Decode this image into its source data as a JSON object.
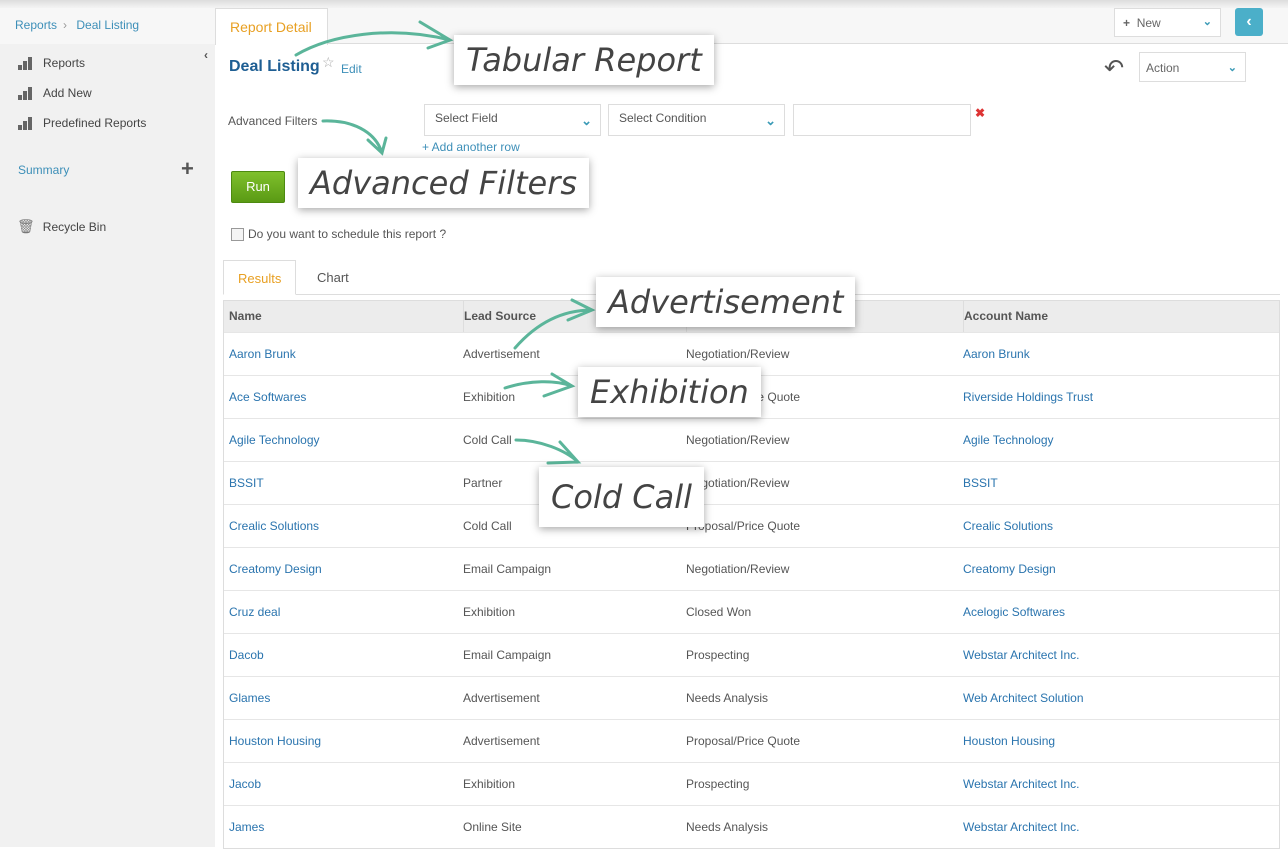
{
  "breadcrumb": {
    "root": "Reports",
    "current": "Deal Listing"
  },
  "sidebar": {
    "items": [
      {
        "label": "Reports",
        "icon": "bar-chart-icon"
      },
      {
        "label": "Add New",
        "icon": "bar-chart-add-icon"
      },
      {
        "label": "Predefined Reports",
        "icon": "bar-chart-icon"
      }
    ],
    "summary": "Summary",
    "recycle": "Recycle Bin"
  },
  "header": {
    "tab": "Report Detail",
    "new_label": "New",
    "action_label": "Action"
  },
  "report": {
    "title": "Deal Listing",
    "edit": "Edit"
  },
  "filters": {
    "label": "Advanced Filters",
    "field_placeholder": "Select Field",
    "condition_placeholder": "Select Condition",
    "value": "",
    "add_row": "+ Add another row",
    "run": "Run",
    "schedule": "Do you want to schedule this report ?"
  },
  "tabs": {
    "results": "Results",
    "chart": "Chart"
  },
  "table": {
    "columns": [
      "Name",
      "Lead Source",
      "",
      "Account Name"
    ],
    "rows": [
      [
        "Aaron Brunk",
        "Advertisement",
        "Negotiation/Review",
        "Aaron Brunk"
      ],
      [
        "Ace Softwares",
        "Exhibition",
        "Proposal/Price Quote",
        "Riverside Holdings Trust"
      ],
      [
        "Agile Technology",
        "Cold Call",
        "Negotiation/Review",
        "Agile Technology"
      ],
      [
        "BSSIT",
        "Partner",
        "Negotiation/Review",
        "BSSIT"
      ],
      [
        "Crealic Solutions",
        "Cold Call",
        "Proposal/Price Quote",
        "Crealic Solutions"
      ],
      [
        "Creatomy Design",
        "Email Campaign",
        "Negotiation/Review",
        "Creatomy Design"
      ],
      [
        "Cruz deal",
        "Exhibition",
        "Closed Won",
        "Acelogic Softwares"
      ],
      [
        "Dacob",
        "Email Campaign",
        "Prospecting",
        "Webstar Architect Inc."
      ],
      [
        "Glames",
        "Advertisement",
        "Needs Analysis",
        "Web Architect Solution"
      ],
      [
        "Houston Housing",
        "Advertisement",
        "Proposal/Price Quote",
        "Houston Housing"
      ],
      [
        "Jacob",
        "Exhibition",
        "Prospecting",
        "Webstar Architect Inc."
      ],
      [
        "James",
        "Online Site",
        "Needs Analysis",
        "Webstar Architect Inc."
      ]
    ]
  },
  "callouts": {
    "tabular": "Tabular Report",
    "filters": "Advanced Filters",
    "advertisement": "Advertisement",
    "exhibition": "Exhibition",
    "cold_call": "Cold Call"
  },
  "colors": {
    "accent": "#e8a023",
    "link": "#2a74ae",
    "run": "#6aae1e",
    "arrow": "#5bb59a"
  }
}
